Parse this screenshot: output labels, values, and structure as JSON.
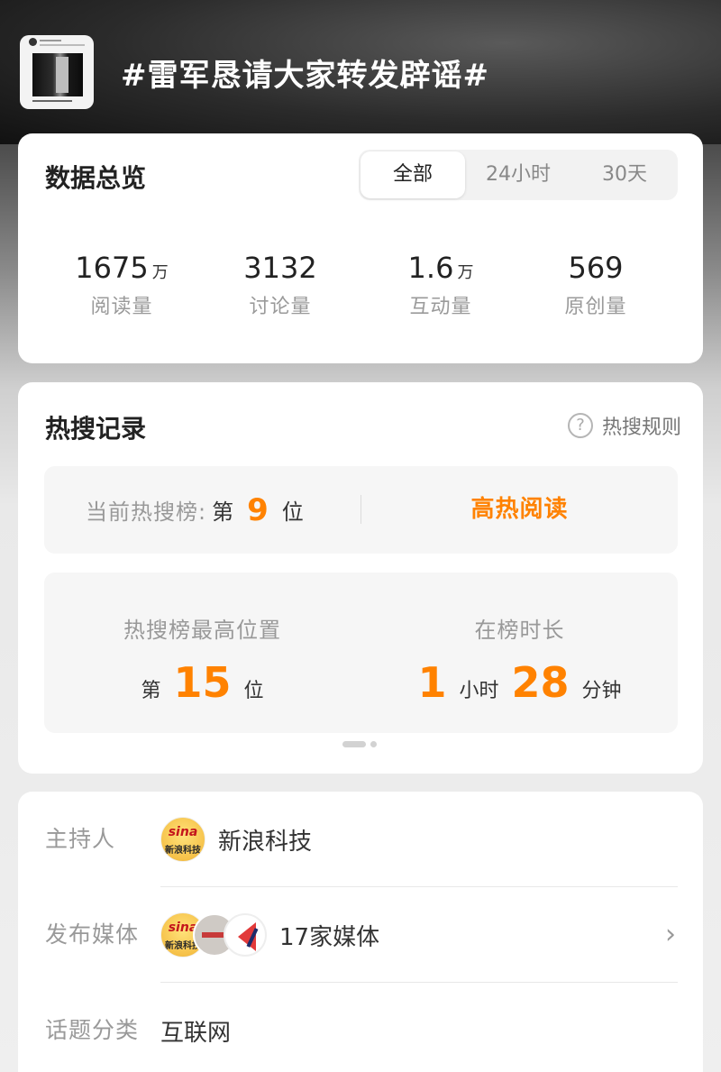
{
  "header": {
    "topic_title": "#雷军恳请大家转发辟谣#"
  },
  "overview": {
    "title": "数据总览",
    "tabs": [
      "全部",
      "24小时",
      "30天"
    ],
    "selected_tab": "全部",
    "stats": [
      {
        "value": "1675",
        "unit": "万",
        "label": "阅读量"
      },
      {
        "value": "3132",
        "unit": "",
        "label": "讨论量"
      },
      {
        "value": "1.6",
        "unit": "万",
        "label": "互动量"
      },
      {
        "value": "569",
        "unit": "",
        "label": "原创量"
      }
    ]
  },
  "hot_search": {
    "title": "热搜记录",
    "rules_label": "热搜规则",
    "rules_icon": "?",
    "current_label": "当前热搜榜:",
    "current_rank_prefix": "第",
    "current_rank": "9",
    "current_rank_suffix": "位",
    "hot_reading": "高热阅读",
    "best_position_label": "热搜榜最高位置",
    "best_rank_prefix": "第",
    "best_rank": "15",
    "best_rank_suffix": "位",
    "duration_label": "在榜时长",
    "duration_hours": "1",
    "duration_hours_unit": "小时",
    "duration_minutes": "28",
    "duration_minutes_unit": "分钟"
  },
  "info": {
    "host_label": "主持人",
    "host_name": "新浪科技",
    "host_logo_text": "sina",
    "host_logo_cn": "新浪科技",
    "media_label": "发布媒体",
    "media_count": "17家媒体",
    "category_label": "话题分类",
    "category_value": "互联网"
  },
  "colors": {
    "accent": "#ff8200",
    "muted": "#999999"
  }
}
